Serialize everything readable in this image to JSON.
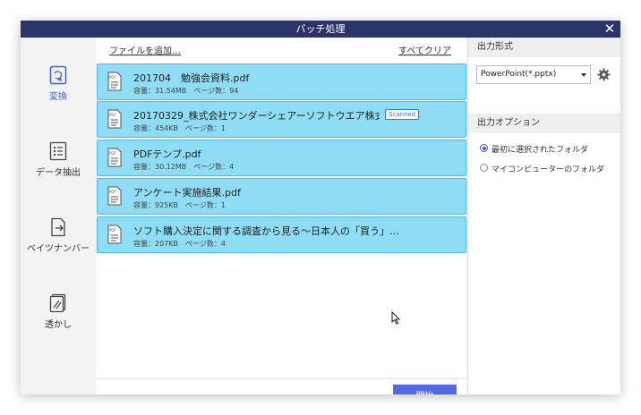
{
  "window": {
    "title": "バッチ処理",
    "close_symbol": "✕"
  },
  "nav": {
    "items": [
      {
        "label": "変換",
        "icon": "convert-icon",
        "active": true
      },
      {
        "label": "データ抽出",
        "icon": "data-extract-icon",
        "active": false
      },
      {
        "label": "ベイツナンバー",
        "icon": "bates-number-icon",
        "active": false
      },
      {
        "label": "透かし",
        "icon": "watermark-icon",
        "active": false
      }
    ]
  },
  "toolbar": {
    "add_files": "ファイルを追加…",
    "clear_all": "すべてクリア"
  },
  "files": [
    {
      "name": "201704　勉強会資料.pdf",
      "meta": "容量：31.54MB　ページ数：94",
      "badge": ""
    },
    {
      "name": "20170329_株式会社ワンダーシェアーソフトウエア株式会…",
      "meta": "容量：454KB　ページ数：1",
      "badge": "Scanned"
    },
    {
      "name": "PDFテンプ.pdf",
      "meta": "容量：30.12MB　ページ数：4",
      "badge": ""
    },
    {
      "name": "アンケート実施結果.pdf",
      "meta": "容量：925KB　ページ数：1",
      "badge": ""
    },
    {
      "name": "ソフト購入決定に関する調査から見る～日本人の「買う」…",
      "meta": "容量：207KB　ページ数：4",
      "badge": ""
    }
  ],
  "start_button": "開始",
  "output": {
    "format_header": "出力形式",
    "format_value": "PowerPoint(*.pptx)",
    "options_header": "出力オプション",
    "options": [
      {
        "label": "最初に選択されたフォルダ",
        "checked": true
      },
      {
        "label": "マイコンピューターのフォルダ",
        "checked": false
      }
    ]
  },
  "colors": {
    "titlebar": "#2a3468",
    "accent": "#3f5fd8",
    "file_row_bg": "#8fdcf5",
    "file_row_border": "#52b6e6",
    "start_button": "#4f6be0"
  }
}
